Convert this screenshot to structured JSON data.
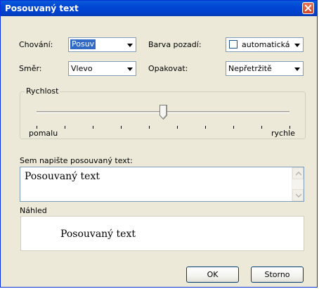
{
  "dialog": {
    "title": "Posouvaný text"
  },
  "behavior": {
    "label": "Chování:",
    "value": "Posuv"
  },
  "direction": {
    "label": "Směr:",
    "value": "Vlevo"
  },
  "background": {
    "label": "Barva pozadí:",
    "value": "automatická",
    "checked": false
  },
  "repeat": {
    "label": "Opakovat:",
    "value": "Nepřetržitě"
  },
  "speed": {
    "group_label": "Rychlost",
    "min_label": "pomalu",
    "max_label": "rychle",
    "tick_count": 10,
    "level": 0.5
  },
  "text_entry": {
    "label": "Sem napište posouvaný text:",
    "value": "Posouvaný text"
  },
  "preview": {
    "label": "Náhled",
    "text": "Posouvaný text"
  },
  "buttons": {
    "ok": "OK",
    "cancel": "Storno"
  },
  "colors": {
    "titlebar": "#0046d5",
    "dialog_bg": "#ece9d8",
    "selection": "#316ac5",
    "close_button": "#d2452b"
  }
}
